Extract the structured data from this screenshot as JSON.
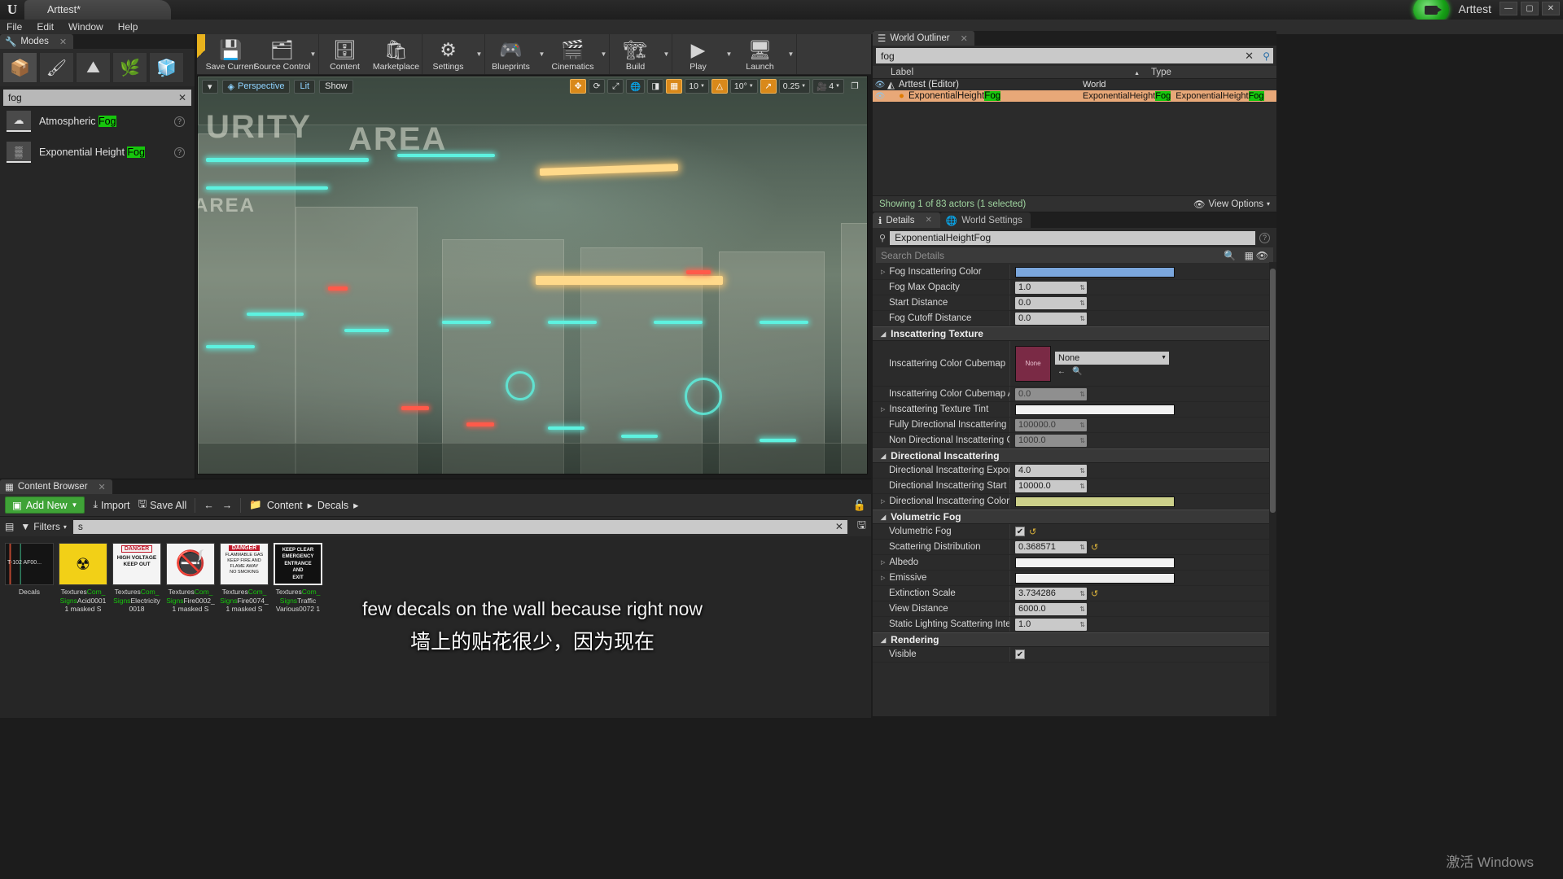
{
  "titlebar": {
    "project_tab": "Arttest*",
    "right_title": "Arttest",
    "window_buttons": [
      "—",
      "▢",
      "✕"
    ]
  },
  "menubar": {
    "items": [
      "File",
      "Edit",
      "Window",
      "Help"
    ]
  },
  "modes_panel": {
    "tab_label": "Modes",
    "mode_buttons": [
      "place-mode-icon",
      "paint-mode-icon",
      "landscape-mode-icon",
      "foliage-mode-icon",
      "geometry-mode-icon"
    ],
    "search_value": "fog",
    "clear_icon": "✕",
    "items": [
      {
        "label_prefix": "Atmospheric ",
        "label_match": "Fog",
        "thumb": "cloud-icon"
      },
      {
        "label_prefix": "Exponential Height ",
        "label_match": "Fog",
        "thumb": "fog-icon"
      }
    ]
  },
  "toolbar": {
    "groups": [
      {
        "items": [
          {
            "label": "Save Current",
            "icon": "💾",
            "arrow": false
          },
          {
            "label": "Source Control",
            "icon": "🗂",
            "arrow": true
          }
        ]
      },
      {
        "items": [
          {
            "label": "Content",
            "icon": "🗄",
            "arrow": false
          },
          {
            "label": "Marketplace",
            "icon": "🛍",
            "arrow": false
          }
        ]
      },
      {
        "items": [
          {
            "label": "Settings",
            "icon": "⚙",
            "arrow": true
          }
        ]
      },
      {
        "items": [
          {
            "label": "Blueprints",
            "icon": "🎮",
            "arrow": true
          },
          {
            "label": "Cinematics",
            "icon": "🎬",
            "arrow": true
          }
        ]
      },
      {
        "items": [
          {
            "label": "Build",
            "icon": "🏗",
            "arrow": true
          }
        ]
      },
      {
        "items": [
          {
            "label": "Play",
            "icon": "▶",
            "arrow": true
          },
          {
            "label": "Launch",
            "icon": "🖥",
            "arrow": true
          }
        ]
      }
    ]
  },
  "viewport": {
    "left_chips": [
      "Perspective",
      "Lit",
      "Show"
    ],
    "menu_caret": "▾",
    "right_controls": [
      {
        "name": "transform-gizmo",
        "text": "",
        "icon": "✥",
        "active": true
      },
      {
        "name": "rotate-gizmo",
        "text": "",
        "icon": "⟳",
        "active": false
      },
      {
        "name": "scale-gizmo",
        "text": "",
        "icon": "⤢",
        "active": false
      },
      {
        "name": "world-space",
        "text": "",
        "icon": "🌐",
        "active": false
      },
      {
        "name": "surface-snap",
        "text": "",
        "icon": "◨",
        "active": false
      },
      {
        "name": "grid-snap-value",
        "text": "10",
        "icon": "",
        "active": true
      },
      {
        "name": "angle-snap-toggle",
        "text": "",
        "icon": "△",
        "active": true
      },
      {
        "name": "angle-snap-value",
        "text": "10°",
        "icon": "",
        "active": false
      },
      {
        "name": "scale-snap-toggle",
        "text": "",
        "icon": "↗",
        "active": true
      },
      {
        "name": "scale-snap-value",
        "text": "0.25",
        "icon": "",
        "active": false
      },
      {
        "name": "camera-speed",
        "text": "4",
        "icon": "🎥",
        "active": false
      },
      {
        "name": "maximize-viewport",
        "text": "",
        "icon": "❐",
        "active": false
      }
    ],
    "scene_texts": [
      "URITY AREA",
      "AREA"
    ]
  },
  "subtitles": {
    "english": "few decals on the wall because right now",
    "chinese": "墙上的贴花很少，因为现在"
  },
  "content_browser": {
    "tab_label": "Content Browser",
    "add_new": "Add New",
    "import": "Import",
    "save_all": "Save All",
    "back_icon": "←",
    "forward_icon": "→",
    "breadcrumb": [
      "Content",
      "Decals"
    ],
    "breadcrumb_sep": "▸",
    "filters_label": "Filters",
    "search_value": "s",
    "clear_icon": "✕",
    "assets": [
      {
        "thumb_text": "T-102  AF00...",
        "name_lines": [
          "Decals"
        ],
        "thumb_kind": "decal-strip"
      },
      {
        "thumb_text": "",
        "name_lines": [
          "Textures",
          "Com_",
          "Signs",
          "Acid0001",
          "1 masked S"
        ],
        "thumb_kind": "radioactive"
      },
      {
        "thumb_text": "DANGER HIGH VOLTAGE KEEP OUT",
        "name_lines": [
          "Textures",
          "Com_",
          "Signs",
          "Electricity0018"
        ],
        "thumb_kind": "danger-voltage"
      },
      {
        "thumb_text": "",
        "name_lines": [
          "Textures",
          "Com_",
          "Signs",
          "Fire0002_",
          "1 masked S"
        ],
        "thumb_kind": "no-fire"
      },
      {
        "thumb_text": "DANGER FLAMMABLE GAS",
        "name_lines": [
          "Textures",
          "Com_",
          "Signs",
          "Fire0074_",
          "1 masked S"
        ],
        "thumb_kind": "danger-gas"
      },
      {
        "thumb_text": "KEEP CLEAR EMERGENCY ENTRANCE AND EXIT",
        "name_lines": [
          "Textures",
          "Com_",
          "Signs",
          "Traffic",
          "Various0072  1"
        ],
        "thumb_kind": "keep-clear"
      }
    ]
  },
  "world_outliner": {
    "tab_label": "World Outliner",
    "search_value": "fog",
    "clear_icon": "✕",
    "pin_icon": "⚲",
    "columns": {
      "label": "Label",
      "type": "Type"
    },
    "sort_caret": "▲",
    "rows": [
      {
        "eye": "👁",
        "icon": "🌍",
        "label": "Arttest (Editor)",
        "type": "World",
        "selected": false,
        "depth": 0
      },
      {
        "eye": "👁",
        "icon": "🔆",
        "label_prefix": "ExponentialHeight",
        "label_match": "Fog",
        "type_prefix": "ExponentialHeight",
        "type_match": "Fog",
        "type2_prefix": "ExponentialHeight",
        "type2_match": "Fog",
        "selected": true,
        "depth": 1
      }
    ],
    "status": "Showing 1 of 83 actors (1 selected)",
    "view_options": "View Options",
    "view_options_icon": "👁"
  },
  "details": {
    "tabs": [
      {
        "label": "Details",
        "icon": "ℹ",
        "active": true,
        "close": "✕"
      },
      {
        "label": "World Settings",
        "icon": "🌐",
        "active": false
      }
    ],
    "actor_name": "ExponentialHeightFog",
    "help_icon": "?",
    "search_placeholder": "Search Details",
    "search_icon": "🔍",
    "grid_icon": "▦",
    "eye_icon": "👁",
    "properties_top": [
      {
        "name": "Fog Inscattering Color",
        "expandable": true,
        "type": "color",
        "color": "#7ba7dd"
      },
      {
        "name": "Fog Max Opacity",
        "expandable": false,
        "type": "number",
        "value": "1.0"
      },
      {
        "name": "Start Distance",
        "expandable": false,
        "type": "number",
        "value": "0.0"
      },
      {
        "name": "Fog Cutoff Distance",
        "expandable": false,
        "type": "number",
        "value": "0.0"
      }
    ],
    "sections": [
      {
        "title": "Inscattering Texture",
        "properties": [
          {
            "name": "Inscattering Color Cubemap",
            "type": "asset",
            "value": "None",
            "thumb_label": "None",
            "tall": true
          },
          {
            "name": "Inscattering Color Cubemap Angle",
            "type": "number",
            "value": "0.0",
            "dim": true
          },
          {
            "name": "Inscattering Texture Tint",
            "expandable": true,
            "type": "color",
            "color": "#f2f2f2"
          },
          {
            "name": "Fully Directional Inscattering Color Dis",
            "type": "number",
            "value": "100000.0",
            "dim": true
          },
          {
            "name": "Non Directional Inscattering Color Dist",
            "type": "number",
            "value": "1000.0",
            "dim": true
          }
        ]
      },
      {
        "title": "Directional Inscattering",
        "properties": [
          {
            "name": "Directional Inscattering Exponent",
            "type": "number",
            "value": "4.0"
          },
          {
            "name": "Directional Inscattering Start Distance",
            "type": "number",
            "value": "10000.0"
          },
          {
            "name": "Directional Inscattering Color",
            "expandable": true,
            "type": "color",
            "color": "#ccd08a"
          }
        ]
      },
      {
        "title": "Volumetric Fog",
        "properties": [
          {
            "name": "Volumetric Fog",
            "type": "checkbox",
            "checked": true,
            "check": "✔",
            "revert": "↺"
          },
          {
            "name": "Scattering Distribution",
            "type": "number",
            "value": "0.368571",
            "revert": "↺"
          },
          {
            "name": "Albedo",
            "expandable": true,
            "type": "color",
            "color": "#f2f2f2"
          },
          {
            "name": "Emissive",
            "expandable": true,
            "type": "color",
            "color": "#efefef"
          },
          {
            "name": "Extinction Scale",
            "type": "number",
            "value": "3.734286",
            "revert": "↺"
          },
          {
            "name": "View Distance",
            "type": "number",
            "value": "6000.0"
          },
          {
            "name": "Static Lighting Scattering Intensity",
            "type": "number",
            "value": "1.0"
          }
        ]
      },
      {
        "title": "Rendering",
        "properties": [
          {
            "name": "Visible",
            "type": "checkbox",
            "checked": true,
            "check": "✔"
          }
        ]
      }
    ]
  },
  "watermark": "激活 Windows"
}
